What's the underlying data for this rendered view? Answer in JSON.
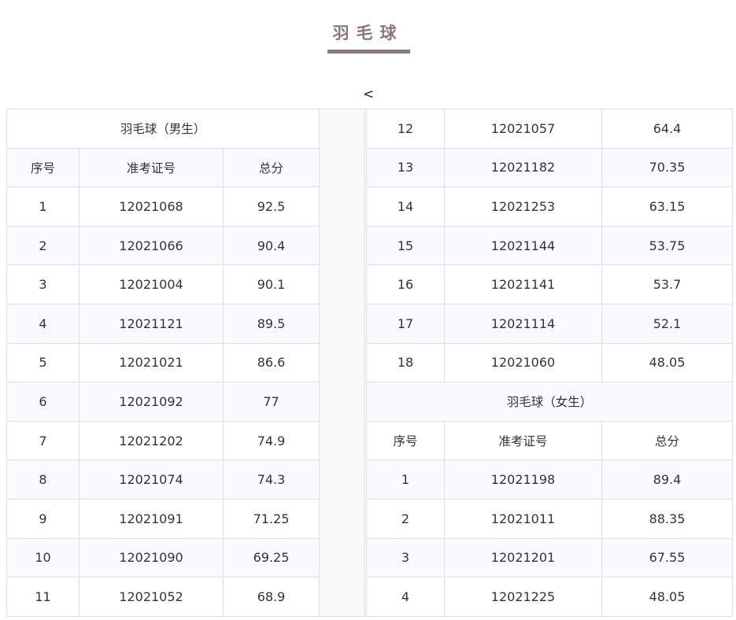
{
  "header": {
    "title": "羽毛球",
    "prev_symbol": "<"
  },
  "columns": [
    "序号",
    "准考证号",
    "总分"
  ],
  "male": {
    "section_title": "羽毛球（男生）",
    "rows": [
      {
        "no": "1",
        "id": "12021068",
        "score": "92.5"
      },
      {
        "no": "2",
        "id": "12021066",
        "score": "90.4"
      },
      {
        "no": "3",
        "id": "12021004",
        "score": "90.1"
      },
      {
        "no": "4",
        "id": "12021121",
        "score": "89.5"
      },
      {
        "no": "5",
        "id": "12021021",
        "score": "86.6"
      },
      {
        "no": "6",
        "id": "12021092",
        "score": "77"
      },
      {
        "no": "7",
        "id": "12021202",
        "score": "74.9"
      },
      {
        "no": "8",
        "id": "12021074",
        "score": "74.3"
      },
      {
        "no": "9",
        "id": "12021091",
        "score": "71.25"
      },
      {
        "no": "10",
        "id": "12021090",
        "score": "69.25"
      },
      {
        "no": "11",
        "id": "12021052",
        "score": "68.9"
      },
      {
        "no": "12",
        "id": "12021057",
        "score": "64.4"
      },
      {
        "no": "13",
        "id": "12021182",
        "score": "70.35"
      },
      {
        "no": "14",
        "id": "12021253",
        "score": "63.15"
      },
      {
        "no": "15",
        "id": "12021144",
        "score": "53.75"
      },
      {
        "no": "16",
        "id": "12021141",
        "score": "53.7"
      },
      {
        "no": "17",
        "id": "12021114",
        "score": "52.1"
      },
      {
        "no": "18",
        "id": "12021060",
        "score": "48.05"
      }
    ]
  },
  "female": {
    "section_title": "羽毛球（女生）",
    "rows": [
      {
        "no": "1",
        "id": "12021198",
        "score": "89.4"
      },
      {
        "no": "2",
        "id": "12021011",
        "score": "88.35"
      },
      {
        "no": "3",
        "id": "12021201",
        "score": "67.55"
      },
      {
        "no": "4",
        "id": "12021225",
        "score": "48.05"
      }
    ]
  }
}
